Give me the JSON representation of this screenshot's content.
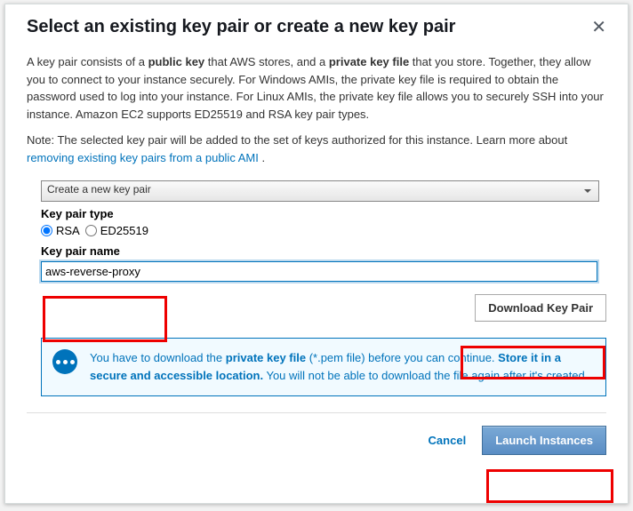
{
  "header": {
    "title": "Select an existing key pair or create a new key pair"
  },
  "body": {
    "para1_a": "A key pair consists of a ",
    "para1_b": "public key",
    "para1_c": " that AWS stores, and a ",
    "para1_d": "private key file",
    "para1_e": " that you store. Together, they allow you to connect to your instance securely. For Windows AMIs, the private key file is required to obtain the password used to log into your instance. For Linux AMIs, the private key file allows you to securely SSH into your instance. Amazon EC2 supports ED25519 and RSA key pair types.",
    "para2_a": "Note: The selected key pair will be added to the set of keys authorized for this instance. Learn more about ",
    "para2_link": "removing existing key pairs from a public AMI",
    "para2_b": " ."
  },
  "form": {
    "select_value": "Create a new key pair",
    "kptype_label": "Key pair type",
    "radio_rsa": "RSA",
    "radio_ed25519": "ED25519",
    "kpname_label": "Key pair name",
    "kpname_value": "aws-reverse-proxy",
    "download_label": "Download Key Pair"
  },
  "alert": {
    "t1": "You have to download the ",
    "t2": "private key file",
    "t3": " (*.pem file) before you can continue. ",
    "t4": "Store it in a secure and accessible location.",
    "t5": " You will not be able to download the file again after it's created."
  },
  "footer": {
    "cancel": "Cancel",
    "launch": "Launch Instances"
  }
}
